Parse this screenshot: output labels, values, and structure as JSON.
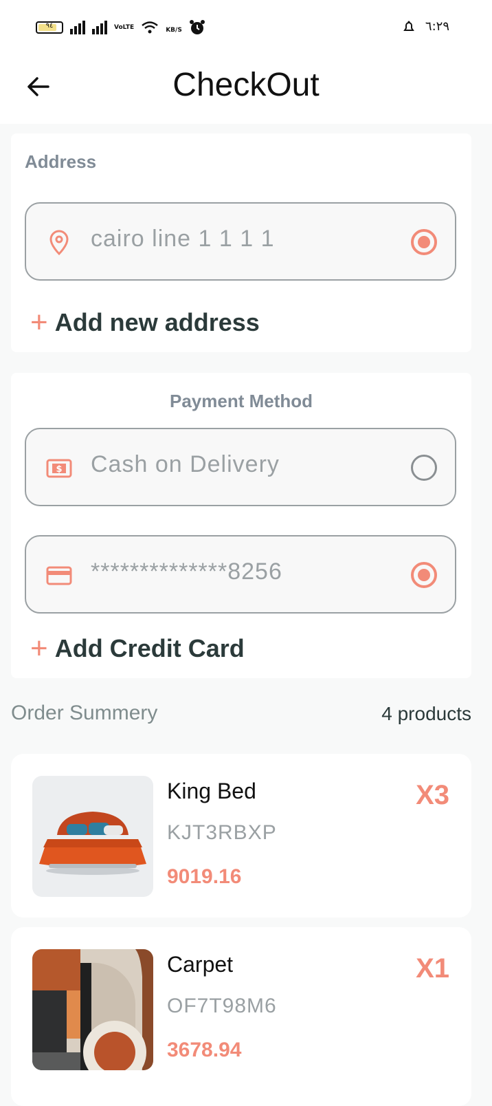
{
  "status_bar": {
    "battery": "٩٤",
    "network": "VoLTE",
    "speed": "KB/S",
    "time": "٦:٢٩"
  },
  "header": {
    "back_icon": "arrow-left-icon",
    "title": "CheckOut"
  },
  "address": {
    "label": "Address",
    "items": [
      {
        "text": "cairo line 1 1 1 1",
        "icon": "location-pin-icon",
        "selected": true
      }
    ],
    "add_label": "Add new address"
  },
  "payment": {
    "label": "Payment Method",
    "options": [
      {
        "text": "Cash on Delivery",
        "icon": "cash-icon",
        "selected": false
      },
      {
        "text": "**************8256",
        "icon": "credit-card-icon",
        "selected": true
      }
    ],
    "add_label": "Add Credit Card"
  },
  "order_summary": {
    "title": "Order Summery",
    "count": "4 products",
    "products": [
      {
        "name": "King Bed",
        "code": "KJT3RBXP",
        "price": "9019.16",
        "quantity": "X3"
      },
      {
        "name": "Carpet",
        "code": "OF7T98M6",
        "price": "3678.94",
        "quantity": "X1"
      }
    ]
  },
  "colors": {
    "accent": "#f28b78",
    "text_dark": "#2b3a3a",
    "muted": "#9aa0a3",
    "background": "#f8f9f9"
  }
}
